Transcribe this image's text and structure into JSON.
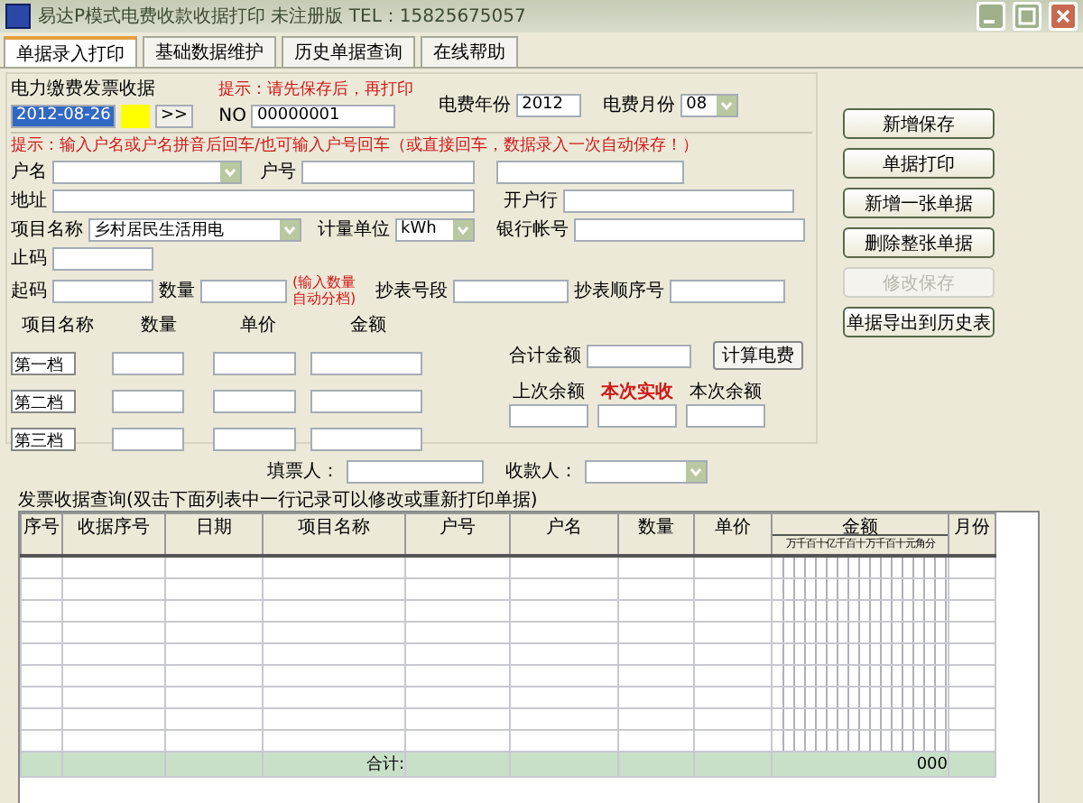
{
  "window": {
    "title": "易达P模式电费收款收据打印 未注册版  TEL：15825675057"
  },
  "tabs": [
    {
      "label": "单据录入打印",
      "selected": true
    },
    {
      "label": "基础数据维护",
      "selected": false
    },
    {
      "label": "历史单据查询",
      "selected": false
    },
    {
      "label": "在线帮助",
      "selected": false
    }
  ],
  "form": {
    "title": "电力缴费发票收据",
    "date": {
      "value": "2012-08-26",
      "text_selected": true
    },
    "next_button": ">>",
    "print_hint": "提示：请先保存后，再打印",
    "number": {
      "label": "NO",
      "value": "00000001"
    },
    "year": {
      "label": "电费年份",
      "value": "2012"
    },
    "month": {
      "label": "电费月份",
      "value": "08"
    },
    "entry_hint": "提示：输入户名或户名拼音后回车/也可输入户号回车（或直接回车，数据录入一次自动保存！）",
    "name_label": "户名",
    "account_label": "户号",
    "address_label": "地址",
    "bank_label": "开户行",
    "item": {
      "label": "项目名称",
      "value": "乡村居民生活用电"
    },
    "unit": {
      "label": "计量单位",
      "value": "kWh"
    },
    "bank_account_label": "银行帐号",
    "end_reading_label": "止码",
    "start_reading_label": "起码",
    "quantity_label": "数量",
    "quantity_hint": "(输入数量自动分档)",
    "meter_section_label": "抄表号段",
    "meter_order_label": "抄表顺序号",
    "tier_columns": [
      "项目名称",
      "数量",
      "单价",
      "金额"
    ],
    "tiers": [
      "第一档",
      "第二档",
      "第三档"
    ],
    "total_label": "合计金额",
    "calculate_button": "计算电费",
    "balances": [
      {
        "label": "上次余额",
        "highlighted": false
      },
      {
        "label": "本次实收",
        "highlighted": true
      },
      {
        "label": "本次余额",
        "highlighted": false
      }
    ],
    "issuer_label": "填票人：",
    "payee_label": "收款人："
  },
  "buttons": [
    {
      "label": "新增保存",
      "disabled": false
    },
    {
      "label": "单据打印",
      "disabled": false
    },
    {
      "label": "新增一张单据",
      "disabled": false
    },
    {
      "label": "删除整张单据",
      "disabled": false
    },
    {
      "label": "修改保存",
      "disabled": true
    },
    {
      "label": "单据导出到历史表",
      "disabled": false
    }
  ],
  "table": {
    "caption": "发票收据查询(双击下面列表中一行记录可以修改或重新打印单据)",
    "columns": [
      "序号",
      "收据序号",
      "日期",
      "项目名称",
      "户号",
      "户名",
      "数量",
      "单价",
      "金额",
      "月份"
    ],
    "amount_digits": "万千百十亿千百十万千百十元角分",
    "total_label": "合计:",
    "total_value": "000"
  }
}
